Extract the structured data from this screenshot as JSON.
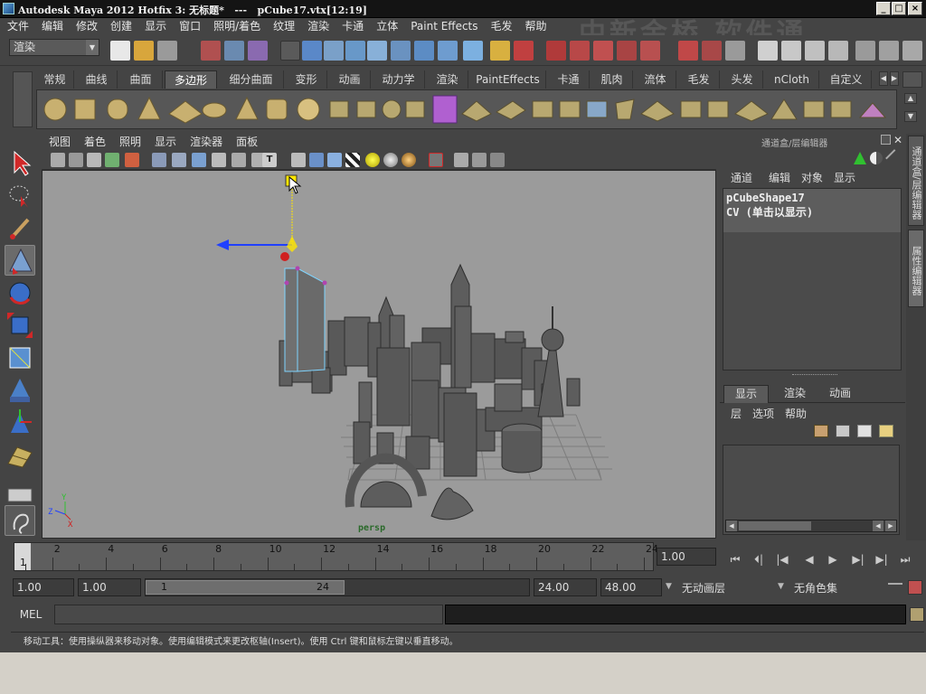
{
  "window": {
    "title": "Autodesk Maya 2012 Hotfix 3: 无标题*   ---   pCube17.vtx[12:19]",
    "buttons": [
      "_",
      "□",
      "×"
    ]
  },
  "menubar": [
    "文件",
    "编辑",
    "修改",
    "创建",
    "显示",
    "窗口",
    "照明/着色",
    "纹理",
    "渲染",
    "卡通",
    "立体",
    "Paint Effects",
    "毛发",
    "帮助"
  ],
  "watermark": "中新金桥 软件通",
  "statusline": {
    "menuset": "渲染"
  },
  "shelf": {
    "tabs": [
      "常规",
      "曲线",
      "曲面",
      "多边形",
      "细分曲面",
      "变形",
      "动画",
      "动力学",
      "渲染",
      "PaintEffects",
      "卡通",
      "肌肉",
      "流体",
      "毛发",
      "头发",
      "nCloth",
      "自定义"
    ],
    "active_tab": "多边形"
  },
  "viewport": {
    "menus": [
      "视图",
      "着色",
      "照明",
      "显示",
      "渲染器",
      "面板"
    ],
    "camera_label": "persp",
    "axis_labels": {
      "y": "Y",
      "z": "Z",
      "x": "X"
    }
  },
  "channel_box": {
    "header": "通道盒/层编辑器",
    "menus": [
      "通道",
      "编辑",
      "对象",
      "显示"
    ],
    "shape_name": "pCubeShape17",
    "cv_text": "CV (单击以显示)"
  },
  "layer_editor": {
    "tabs": [
      "显示",
      "渲染",
      "动画"
    ],
    "active_tab": "显示",
    "menus": [
      "层",
      "选项",
      "帮助"
    ]
  },
  "side_tabs": [
    "通道盒/层编辑器",
    "属性编辑器"
  ],
  "time_slider": {
    "ticks": [
      "2",
      "4",
      "6",
      "8",
      "10",
      "12",
      "14",
      "16",
      "18",
      "20",
      "22",
      "24"
    ],
    "current_frame_marker": "1",
    "current_time": "1.00"
  },
  "playback_buttons": [
    "⏮",
    "⏴|",
    "|◀",
    "◀",
    "▶",
    "▶|",
    "▶|",
    "⏭"
  ],
  "range": {
    "start": "1.00",
    "playback_start": "1.00",
    "slider_start": "1",
    "slider_end": "24",
    "playback_end": "24.00",
    "end": "48.00",
    "anim_layer": "无动画层",
    "character_set": "无角色集"
  },
  "command_line": {
    "label": "MEL"
  },
  "help_line": "移动工具：使用操纵器来移动对象。使用编辑模式来更改枢轴(Insert)。使用 Ctrl 键和鼠标左键以垂直移动。",
  "colors": {
    "accent_selection": "#7fd4ff",
    "manip_x": "#2040ff",
    "manip_y": "#ffe600",
    "manip_z": "#d02020"
  }
}
